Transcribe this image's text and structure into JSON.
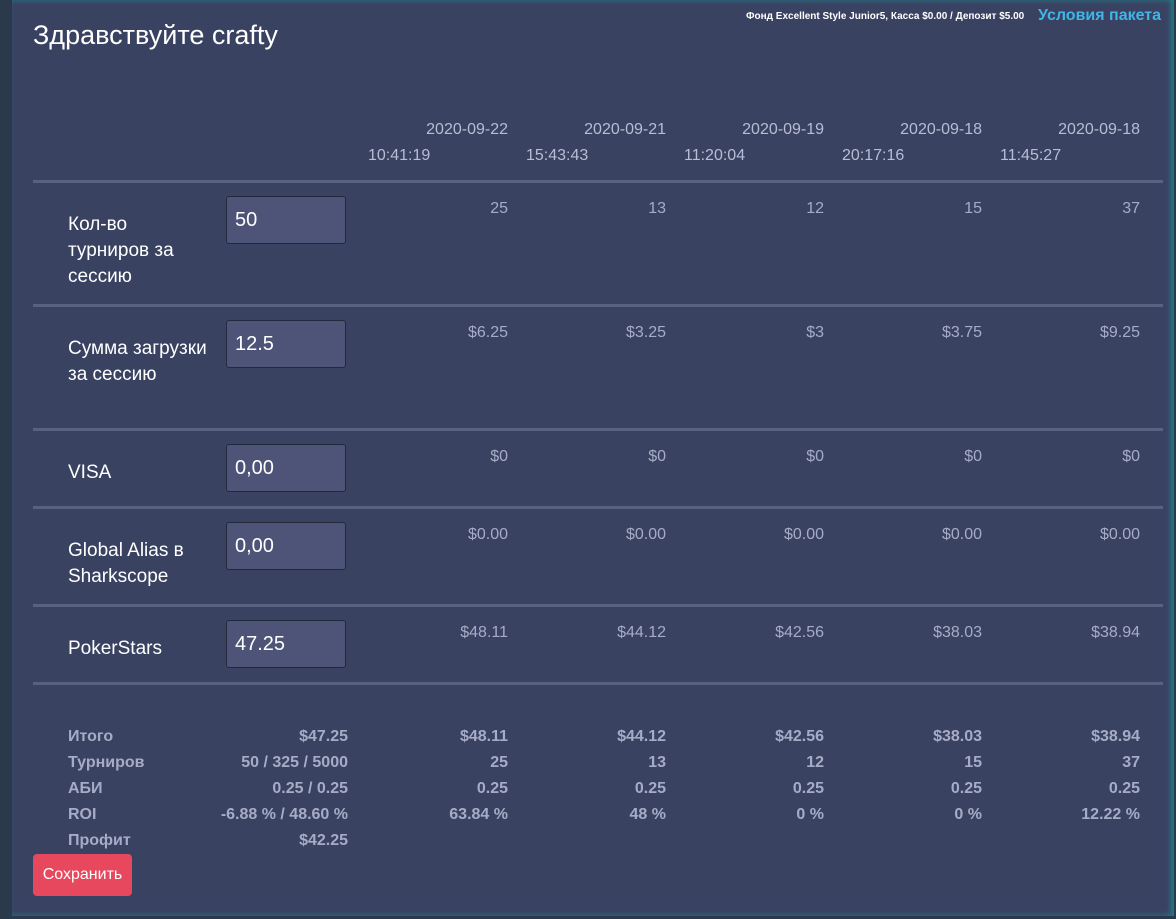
{
  "header": {
    "greeting": "Здравствуйте crafty",
    "fund_info": "Фонд Excellent Style Junior5, Касса $0.00 / Депозит $5.00",
    "package_link": "Условия пакета"
  },
  "dates": [
    {
      "date": "2020-09-22",
      "time": "10:41:19"
    },
    {
      "date": "2020-09-21",
      "time": "15:43:43"
    },
    {
      "date": "2020-09-19",
      "time": "11:20:04"
    },
    {
      "date": "2020-09-18",
      "time": "20:17:16"
    },
    {
      "date": "2020-09-18",
      "time": "11:45:27"
    }
  ],
  "rows": [
    {
      "label": "Кол-во турниров за сессию",
      "input": "50",
      "values": [
        "25",
        "13",
        "12",
        "15",
        "37"
      ]
    },
    {
      "label": "Сумма загрузки за сессию",
      "input": "12.5",
      "values": [
        "$6.25",
        "$3.25",
        "$3",
        "$3.75",
        "$9.25"
      ]
    },
    {
      "label": "VISA",
      "input": "0,00",
      "values": [
        "$0",
        "$0",
        "$0",
        "$0",
        "$0"
      ]
    },
    {
      "label": "Global Alias в Sharkscope",
      "input": "0,00",
      "values": [
        "$0.00",
        "$0.00",
        "$0.00",
        "$0.00",
        "$0.00"
      ]
    },
    {
      "label": "PokerStars",
      "input": "47.25",
      "values": [
        "$48.11",
        "$44.12",
        "$42.56",
        "$38.03",
        "$38.94"
      ]
    }
  ],
  "summary": [
    {
      "label": "Итого",
      "total": "$47.25",
      "values": [
        "$48.11",
        "$44.12",
        "$42.56",
        "$38.03",
        "$38.94"
      ]
    },
    {
      "label": "Турниров",
      "total": "50 / 325 / 5000",
      "values": [
        "25",
        "13",
        "12",
        "15",
        "37"
      ]
    },
    {
      "label": "АБИ",
      "total": "0.25 / 0.25",
      "values": [
        "0.25",
        "0.25",
        "0.25",
        "0.25",
        "0.25"
      ]
    },
    {
      "label": "ROI",
      "total": "-6.88 % / 48.60 %",
      "values": [
        "63.84 %",
        "48 %",
        "0 %",
        "0 %",
        "12.22 %"
      ]
    },
    {
      "label": "Профит",
      "total": "$42.25",
      "values": [
        "",
        "",
        "",
        "",
        ""
      ]
    }
  ],
  "save_button": "Сохранить"
}
